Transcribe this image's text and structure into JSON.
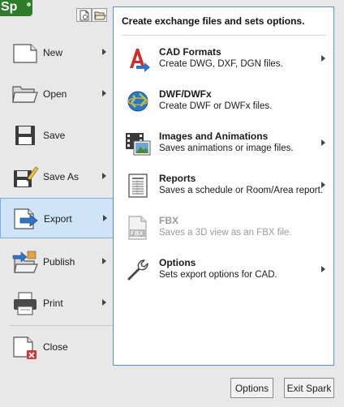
{
  "app": {
    "logo_text": "Sp"
  },
  "quick_access": [
    {
      "icon": "new-file-icon"
    },
    {
      "icon": "open-folder-icon"
    }
  ],
  "menu": {
    "items": [
      {
        "label": "New",
        "icon": "new-document-icon",
        "has_submenu": true
      },
      {
        "label": "Open",
        "icon": "open-folder-icon",
        "has_submenu": true
      },
      {
        "label": "Save",
        "icon": "floppy-disk-icon",
        "has_submenu": false
      },
      {
        "label": "Save As",
        "icon": "save-as-icon",
        "has_submenu": true
      },
      {
        "label": "Export",
        "icon": "export-icon",
        "has_submenu": true,
        "selected": true
      },
      {
        "label": "Publish",
        "icon": "publish-icon",
        "has_submenu": true
      },
      {
        "label": "Print",
        "icon": "printer-icon",
        "has_submenu": true
      },
      {
        "label": "Close",
        "icon": "close-document-icon",
        "has_submenu": false
      }
    ]
  },
  "export_panel": {
    "header": "Create exchange files and sets options.",
    "options": [
      {
        "title": "CAD Formats",
        "desc": "Create DWG, DXF, DGN files.",
        "icon": "cad-formats-icon",
        "has_submenu": true,
        "enabled": true
      },
      {
        "title": "DWF/DWFx",
        "desc": "Create DWF or DWFx files.",
        "icon": "globe-icon",
        "has_submenu": false,
        "enabled": true
      },
      {
        "title": "Images and Animations",
        "desc": "Saves animations or image files.",
        "icon": "film-image-icon",
        "has_submenu": true,
        "enabled": true
      },
      {
        "title": "Reports",
        "desc": "Saves a schedule or Room/Area report.",
        "icon": "report-icon",
        "has_submenu": true,
        "enabled": true
      },
      {
        "title": "FBX",
        "desc": "Saves a 3D view as an FBX file.",
        "icon": "fbx-file-icon",
        "has_submenu": false,
        "enabled": false
      },
      {
        "title": "Options",
        "desc": "Sets export options for CAD.",
        "icon": "wrench-icon",
        "has_submenu": true,
        "enabled": true
      }
    ]
  },
  "footer": {
    "options_label": "Options",
    "exit_label": "Exit Spark"
  },
  "colors": {
    "accent_blue": "#5a91c8",
    "selected_bg": "#cfe4f7",
    "logo_green": "#2f7d2a",
    "disabled_text": "#9a9a9a"
  }
}
